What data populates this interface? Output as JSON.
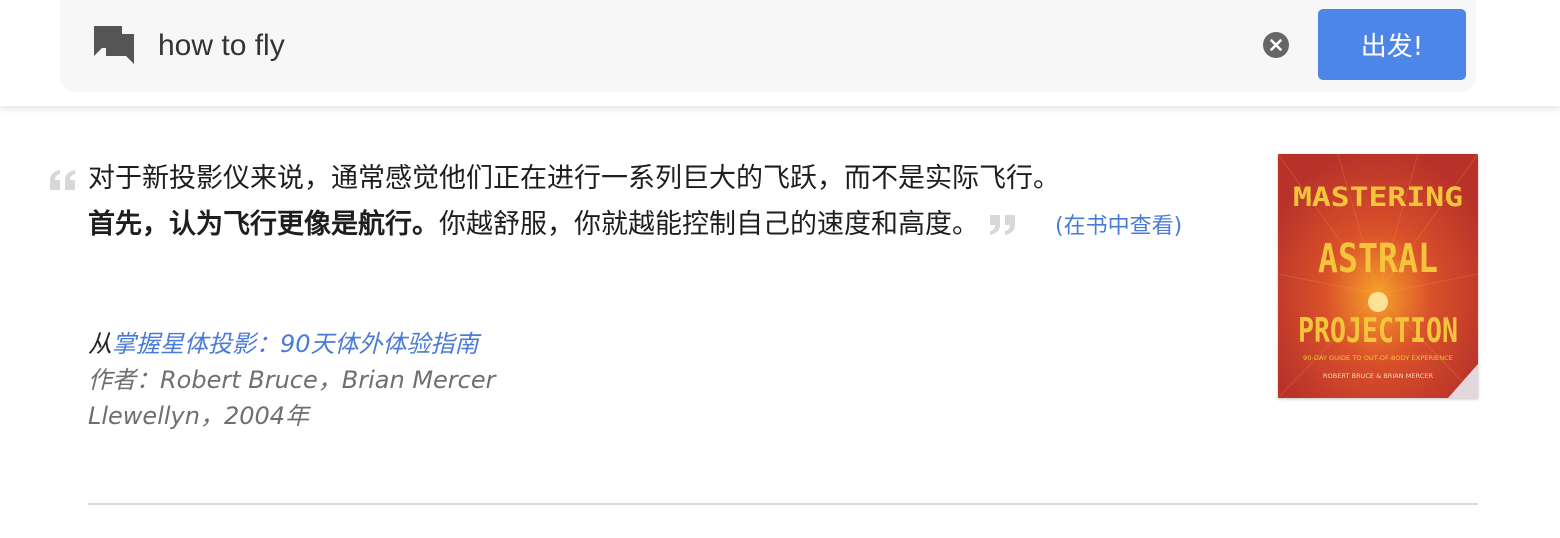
{
  "search": {
    "query": "how to fly",
    "submit_label": "出发!"
  },
  "result": {
    "quote_part1": "对于新投影仪来说，通常感觉他们正在进行一系列巨大的飞跃，而不是实际飞行。",
    "quote_bold": "首先，认为飞行更像是航行。",
    "quote_part2": "你越舒服，你就越能控制自己的速度和高度。",
    "view_in_book": "(在书中查看)",
    "source_prefix": "从",
    "book_title": "掌握星体投影：90天体外体验指南",
    "authors": "作者：Robert Bruce，Brian Mercer",
    "publisher_year": "Llewellyn，2004年",
    "cover": {
      "line1": "MASTERING",
      "line2": "ASTRAL",
      "line3": "PROJECTION",
      "subtitle": "90-DAY GUIDE TO OUT-OF-BODY EXPERIENCE",
      "authors": "ROBERT BRUCE & BRIAN MERCER",
      "bg_color": "#c93a2a",
      "text_color": "#f3c53c"
    }
  },
  "colors": {
    "accent": "#4d86e8",
    "link": "#4a7bd8"
  }
}
